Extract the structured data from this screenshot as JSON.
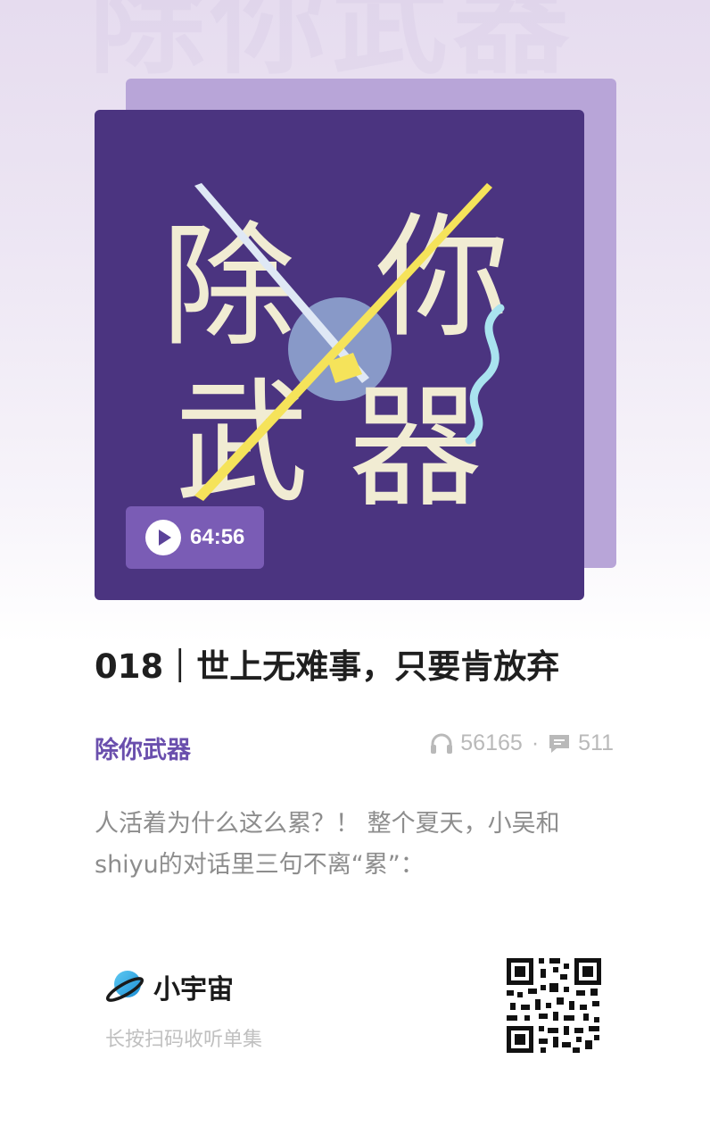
{
  "cover": {
    "art_title": "除你武器",
    "duration": "64:56"
  },
  "episode": {
    "title": "018｜世上无难事，只要肯放弃",
    "podcast_name": "除你武器",
    "plays": "56165",
    "separator": "·",
    "comments": "511",
    "description_line1": "人活着为什么这么累？！ 整个夏天，小吴和",
    "description_line2": "shiyu的对话里三句不离“累”："
  },
  "footer": {
    "brand": "小宇宙",
    "hint": "长按扫码收听单集"
  },
  "colors": {
    "accent": "#6a4fad",
    "cover_bg": "#4b3480",
    "back_card": "#b8a5d8"
  },
  "icons": [
    "play-icon",
    "headphones-icon",
    "comment-icon",
    "planet-logo-icon",
    "qr-code"
  ]
}
